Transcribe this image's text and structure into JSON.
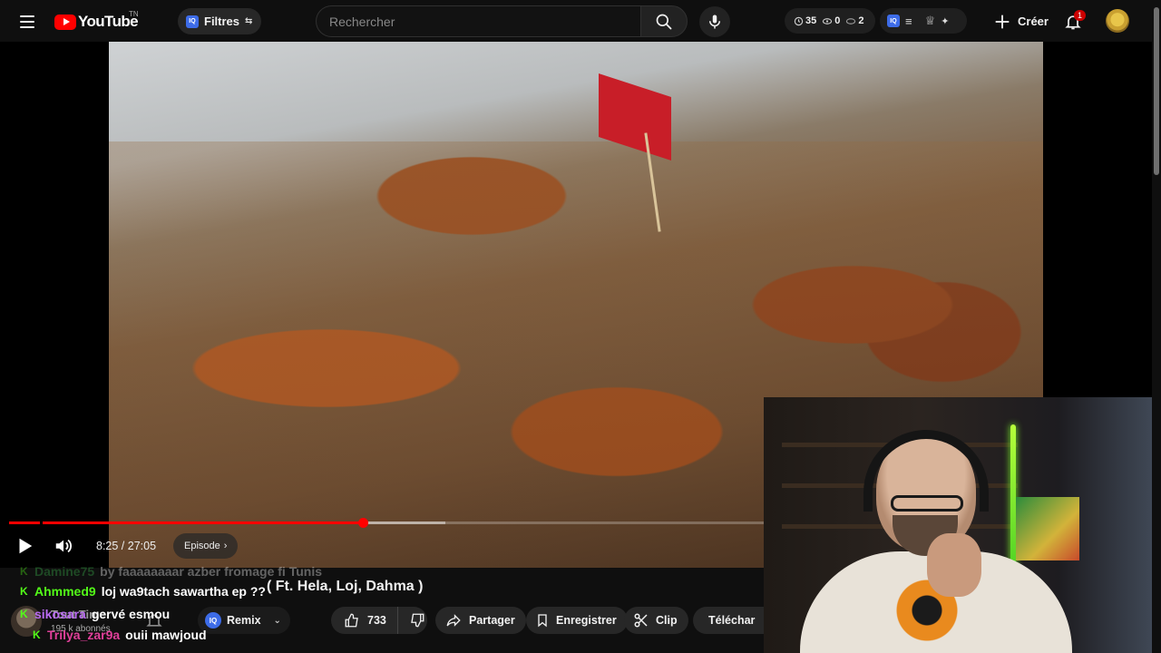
{
  "header": {
    "logo_text": "YouTube",
    "logo_sup": "TN",
    "filters_label": "Filtres",
    "iq_label": "IQ",
    "search_placeholder": "Rechercher",
    "stats": {
      "views": "35",
      "watching": "0",
      "hidden": "2"
    },
    "create_label": "Créer",
    "notif_count": "1"
  },
  "player": {
    "current_time": "8:25",
    "duration": "27:05",
    "time_display": "8:25 / 27:05",
    "progress_fraction": 0.311,
    "episode_label": "Episode"
  },
  "video": {
    "title": "( Ft. Hela, Loj, Dahma )",
    "title_overlay": "by faaaaaaaar azber fromage fi Tunis",
    "channel_subs": "195 k abonnés",
    "channel_name": "Tout Time",
    "remix_label": "Remix",
    "like_count": "733",
    "share_label": "Partager",
    "save_label": "Enregistrer",
    "clip_label": "Clip",
    "download_label": "Téléchar"
  },
  "chat": [
    {
      "user": "Damine75",
      "message": "by faaaaaaaar azber fromage fi Tunis",
      "color": "#3cb44b",
      "faded": true
    },
    {
      "user": "Ahmmed9",
      "message": "loj wa9tach sawartha ep ??",
      "color": "#53fc18",
      "faded": false
    },
    {
      "user": "sikosara",
      "message": "gervé esmou",
      "color": "#b96bf2",
      "faded": false
    },
    {
      "user": "Trilya_zar9a",
      "message": "ouii mawjoud",
      "color": "#e0409a",
      "faded": false
    }
  ],
  "colors": {
    "accent": "#ff0000",
    "background": "#0f0f0f",
    "chip": "#272727",
    "kick_green": "#53fc18"
  },
  "icons": {
    "menu": "hamburger-icon",
    "search": "search-icon",
    "mic": "microphone-icon",
    "create": "plus-icon",
    "bell": "bell-icon",
    "play": "play-icon",
    "volume": "volume-icon",
    "like": "thumbs-up-icon",
    "dislike": "thumbs-down-icon",
    "share": "share-arrow-icon",
    "save": "bookmark-icon",
    "clip": "scissors-icon",
    "download": "download-icon"
  }
}
